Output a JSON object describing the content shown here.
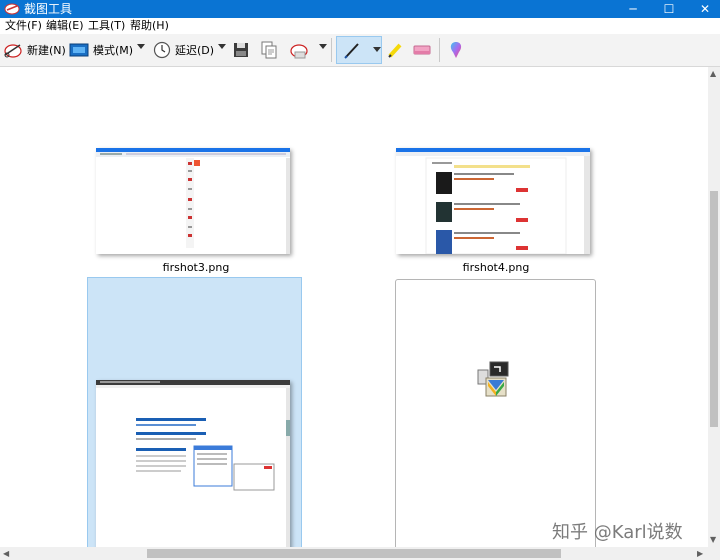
{
  "window": {
    "title": "截图工具",
    "minimize": "─",
    "maximize": "☐",
    "close": "✕"
  },
  "menu": [
    "文件(F)",
    "编辑(E)",
    "工具(T)",
    "帮助(H)"
  ],
  "toolbar": {
    "new_label": "新建(N)",
    "mode_label": "模式(M)",
    "delay_label": "延迟(D)",
    "icons": [
      "new-snip-icon",
      "mode-icon",
      "delay-clock-icon",
      "save-icon",
      "copy-icon",
      "send-icon",
      "pen-icon",
      "highlighter-icon",
      "eraser-icon",
      "paint3d-icon"
    ]
  },
  "files": [
    {
      "name": "firshot3.png"
    },
    {
      "name": "firshot4.png"
    },
    {
      "name": ""
    },
    {
      "name": ""
    }
  ],
  "preview_text": {
    "doc_line1": "If you're on the Firefox page, please navigate to the link",
    "doc_line2": "Can I skip this page, when I'm redirected?",
    "doc_line3": "Enabling Firefox - update detail"
  },
  "watermark": "知乎 @Karl说数",
  "colors": {
    "titlebar": "#0a74d3",
    "selection": "#cce4f7",
    "selection_border": "#99c9ef"
  }
}
